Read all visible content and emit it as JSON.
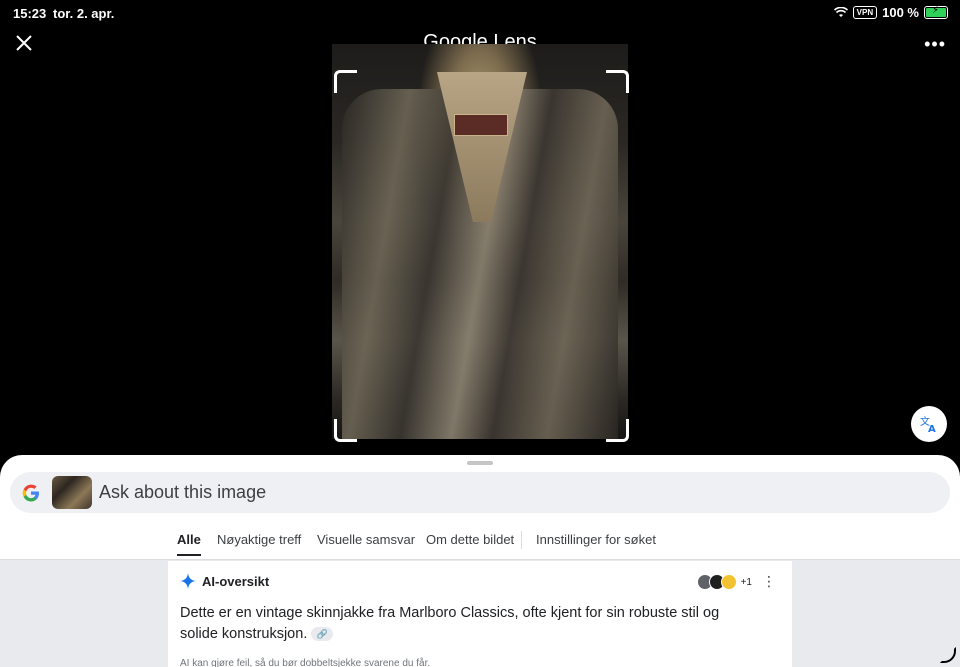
{
  "status_bar": {
    "time": "15:23",
    "date": "tor. 2. apr.",
    "vpn": "VPN",
    "battery": "100 %"
  },
  "header": {
    "title": "Google Lens",
    "close_icon": "close-icon",
    "more_icon": "more-horiz-icon"
  },
  "image": {
    "description_icon": "leather-jacket-photo"
  },
  "search": {
    "placeholder": "Ask about this image"
  },
  "tabs": [
    "Alle",
    "Nøyaktige treff",
    "Visuelle samsvar",
    "Om dette bildet",
    "Innstillinger for søket"
  ],
  "ai_overview": {
    "title": "AI-oversikt",
    "text": "Dette er en vintage skinnjakke fra Marlboro Classics, ofte kjent for sin robuste stil og solide konstruksjon.",
    "sources_more": "+1",
    "disclaimer": "AI kan gjøre feil, så du bør dobbeltsjekke svarene du får."
  },
  "colors": {
    "accent": "#1a73e8",
    "sheet_bg": "#ffffff",
    "results_bg": "#e8eaed"
  }
}
